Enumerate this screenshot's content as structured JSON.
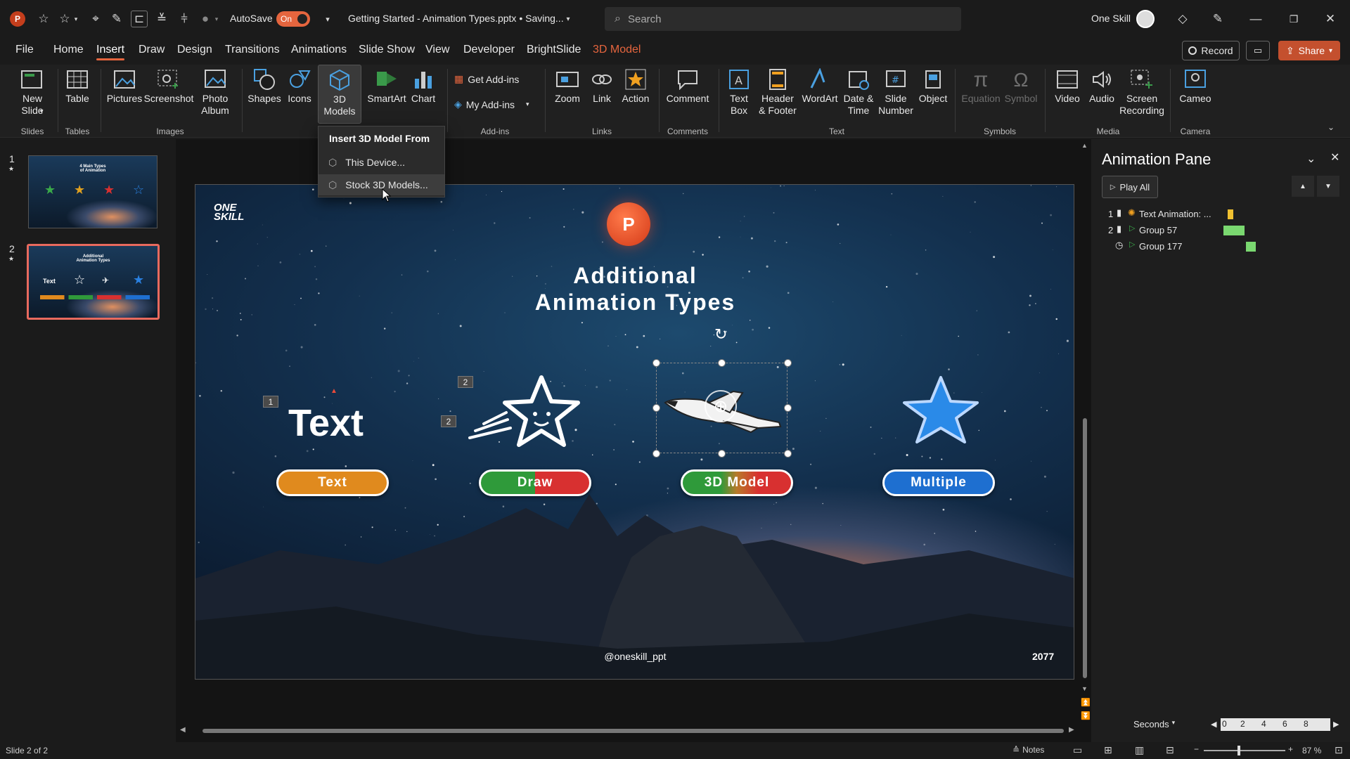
{
  "titlebar": {
    "autosave_label": "AutoSave",
    "autosave_state": "On",
    "doc_title": "Getting Started - Animation Types.pptx • Saving...",
    "search_placeholder": "Search",
    "user_name": "One Skill"
  },
  "menu": {
    "items": [
      "File",
      "Home",
      "Insert",
      "Draw",
      "Design",
      "Transitions",
      "Animations",
      "Slide Show",
      "View",
      "Developer",
      "BrightSlide",
      "3D Model"
    ],
    "active": "Insert",
    "record_label": "Record",
    "share_label": "Share"
  },
  "ribbon": {
    "new_slide": "New\nSlide",
    "table": "Table",
    "pictures": "Pictures",
    "screenshot": "Screenshot",
    "photo_album": "Photo\nAlbum",
    "shapes": "Shapes",
    "icons": "Icons",
    "models3d": "3D\nModels",
    "smartart": "SmartArt",
    "chart": "Chart",
    "get_addins": "Get Add-ins",
    "my_addins": "My Add-ins",
    "zoom": "Zoom",
    "link": "Link",
    "action": "Action",
    "comment": "Comment",
    "text_box": "Text\nBox",
    "header_footer": "Header\n& Footer",
    "wordart": "WordArt",
    "date_time": "Date &\nTime",
    "slide_number": "Slide\nNumber",
    "object": "Object",
    "equation": "Equation",
    "symbol": "Symbol",
    "video": "Video",
    "audio": "Audio",
    "screen_recording": "Screen\nRecording",
    "cameo": "Cameo",
    "groups": {
      "slides": "Slides",
      "tables": "Tables",
      "images": "Images",
      "addins": "Add-ins",
      "links": "Links",
      "comments": "Comments",
      "text": "Text",
      "symbols": "Symbols",
      "media": "Media",
      "camera": "Camera"
    }
  },
  "dropdown": {
    "header": "Insert 3D Model From",
    "items": [
      "This Device...",
      "Stock 3D Models..."
    ]
  },
  "thumbs": [
    {
      "num": "1",
      "title": "4 Main Types\nof Animation"
    },
    {
      "num": "2",
      "title": "Additional\nAnimation Types",
      "label": "Text"
    }
  ],
  "slide": {
    "title_line1": "Additional",
    "title_line2": "Animation Types",
    "logo_line1": "ONE",
    "logo_line2": "SKILL",
    "big_text": "Text",
    "pills": [
      "Text",
      "Draw",
      "3D Model",
      "Multiple"
    ],
    "handle": "@oneskill_ppt",
    "year": "2077",
    "anim_tags": [
      "1",
      "2",
      "2"
    ]
  },
  "pane": {
    "title": "Animation Pane",
    "play_all": "Play All",
    "rows": [
      {
        "num": "1",
        "name": "Text Animation: ..."
      },
      {
        "num": "2",
        "name": "Group 57"
      },
      {
        "num": "",
        "name": "Group 177"
      }
    ],
    "seconds_label": "Seconds",
    "timeline": [
      "0",
      "2",
      "4",
      "6",
      "8"
    ]
  },
  "status": {
    "slide_info": "Slide 2 of 2",
    "notes": "Notes",
    "zoom": "87 %"
  },
  "colors": {
    "accent": "#e5653e",
    "pill_text": "#e08a1e",
    "pill_draw_left": "#2f9a3a",
    "pill_draw_right": "#d8322a",
    "pill_multiple": "#1e6fd0"
  }
}
